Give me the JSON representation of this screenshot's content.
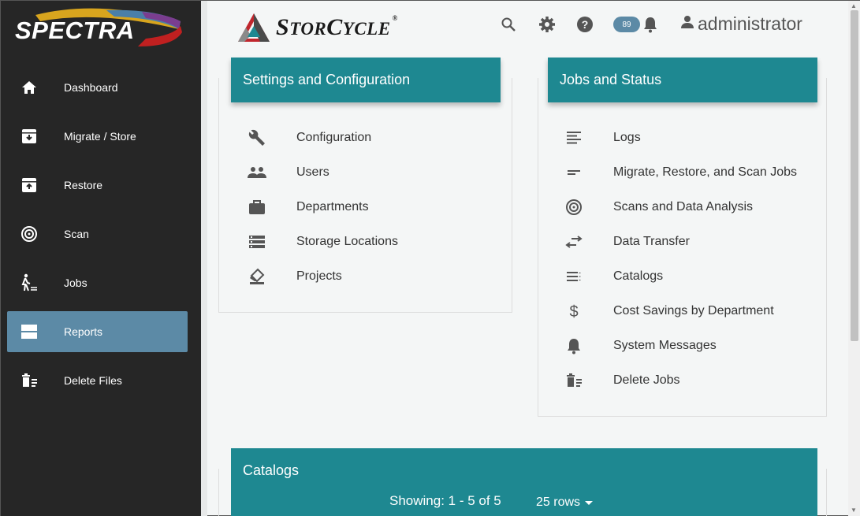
{
  "brand": {
    "name": "SPECTRA"
  },
  "app": {
    "logo_main": "S",
    "logo_rest": "TOR",
    "logo_c": "C",
    "logo_rest2": "YCLE",
    "registered": "®"
  },
  "header": {
    "notification_count": "89",
    "username": "administrator"
  },
  "sidebar": {
    "items": [
      {
        "label": "Dashboard",
        "icon": "home-icon"
      },
      {
        "label": "Migrate / Store",
        "icon": "archive-down-icon"
      },
      {
        "label": "Restore",
        "icon": "archive-up-icon"
      },
      {
        "label": "Scan",
        "icon": "scan-target-icon"
      },
      {
        "label": "Jobs",
        "icon": "jobs-walker-icon"
      },
      {
        "label": "Reports",
        "icon": "reports-icon",
        "active": true
      },
      {
        "label": "Delete Files",
        "icon": "delete-files-icon"
      }
    ]
  },
  "settings": {
    "title": "Settings and Configuration",
    "items": [
      {
        "label": "Configuration",
        "icon": "wrench-icon"
      },
      {
        "label": "Users",
        "icon": "users-icon"
      },
      {
        "label": "Departments",
        "icon": "briefcase-icon"
      },
      {
        "label": "Storage Locations",
        "icon": "storage-list-icon"
      },
      {
        "label": "Projects",
        "icon": "projects-eraser-icon"
      }
    ]
  },
  "jobs": {
    "title": "Jobs and Status",
    "items": [
      {
        "label": "Logs",
        "icon": "logs-lines-icon"
      },
      {
        "label": "Migrate, Restore, and Scan Jobs",
        "icon": "short-lines-icon"
      },
      {
        "label": "Scans and Data Analysis",
        "icon": "scan-target-icon"
      },
      {
        "label": "Data Transfer",
        "icon": "transfer-arrows-icon"
      },
      {
        "label": "Catalogs",
        "icon": "catalog-list-icon"
      },
      {
        "label": "Cost Savings by Department",
        "icon": "dollar-icon"
      },
      {
        "label": "System Messages",
        "icon": "bell-icon"
      },
      {
        "label": "Delete Jobs",
        "icon": "delete-jobs-icon"
      }
    ]
  },
  "catalogs": {
    "title": "Catalogs",
    "showing": "Showing: 1 - 5 of 5",
    "rows": "25 rows"
  },
  "colors": {
    "sidebar_bg": "#262626",
    "active_nav": "#5c8aa6",
    "panel_header": "#1e8891"
  }
}
